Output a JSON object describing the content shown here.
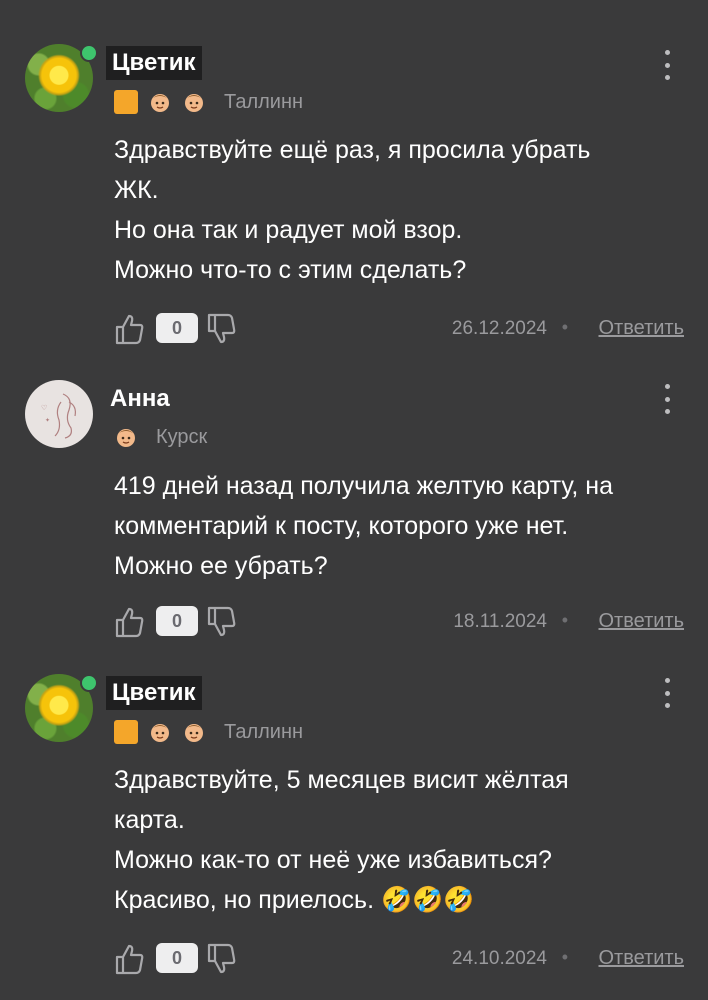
{
  "comments": [
    {
      "author": "Цветик",
      "city": "Таллинн",
      "text": "Здравствуйте ещё раз, я просила убрать\nЖК.\nНо она так и радует мой взор.\nМожно что-то с этим сделать?",
      "score": "0",
      "date": "26.12.2024",
      "reply_label": "Ответить",
      "separator": "•"
    },
    {
      "author": "Анна",
      "city": "Курск",
      "text": "419 дней назад получила желтую карту, на\nкомментарий к посту, которого уже нет.\nМожно ее убрать?",
      "score": "0",
      "date": "18.11.2024",
      "reply_label": "Ответить",
      "separator": "•"
    },
    {
      "author": "Цветик",
      "city": "Таллинн",
      "text": "Здравствуйте, 5 месяцев висит жёлтая\nкарта.\nМожно как-то от неё уже избавиться?\nКрасиво, но приелось. 🤣🤣🤣",
      "score": "0",
      "date": "24.10.2024",
      "reply_label": "Ответить",
      "separator": "•"
    }
  ],
  "colors": {
    "background": "#3a3a3b",
    "online": "#3ec46d",
    "yellow_card": "#f4a62a",
    "muted_text": "#9a9a9d"
  }
}
